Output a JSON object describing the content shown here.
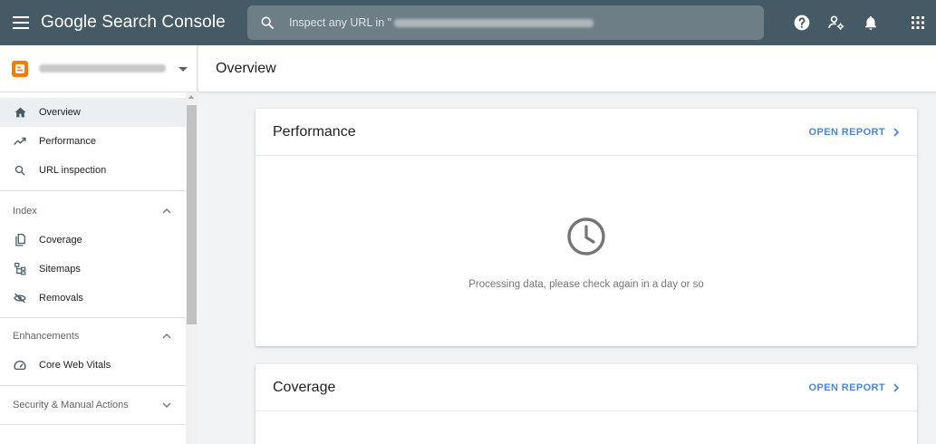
{
  "topbar": {
    "brand": "Google Search Console",
    "search_placeholder": "Inspect any URL in \"",
    "search_value": ""
  },
  "icons": {
    "menu": "menu-icon",
    "search": "search-icon",
    "help": "help-icon",
    "users_settings": "manage-users-icon",
    "notifications": "bell-icon",
    "apps": "apps-grid-icon"
  },
  "sidebar": {
    "primary": [
      {
        "label": "Overview",
        "icon": "home-icon",
        "active": true
      },
      {
        "label": "Performance",
        "icon": "trending-icon"
      },
      {
        "label": "URL inspection",
        "icon": "search-icon"
      }
    ],
    "sections": [
      {
        "title": "Index",
        "expanded": true,
        "items": [
          {
            "label": "Coverage",
            "icon": "copy-icon"
          },
          {
            "label": "Sitemaps",
            "icon": "sitemap-icon"
          },
          {
            "label": "Removals",
            "icon": "eye-off-icon"
          }
        ]
      },
      {
        "title": "Enhancements",
        "expanded": true,
        "items": [
          {
            "label": "Core Web Vitals",
            "icon": "speedometer-icon"
          }
        ]
      },
      {
        "title": "Security & Manual Actions",
        "expanded": false,
        "items": []
      }
    ]
  },
  "main": {
    "title": "Overview",
    "cards": [
      {
        "title": "Performance",
        "action": "OPEN REPORT",
        "message": "Processing data, please check again in a day or so"
      },
      {
        "title": "Coverage",
        "action": "OPEN REPORT"
      }
    ]
  },
  "colors": {
    "topbar": "#455a64",
    "accent": "#4a86d9",
    "blogger": "#f57d00",
    "active_nav": "#eceff1"
  }
}
